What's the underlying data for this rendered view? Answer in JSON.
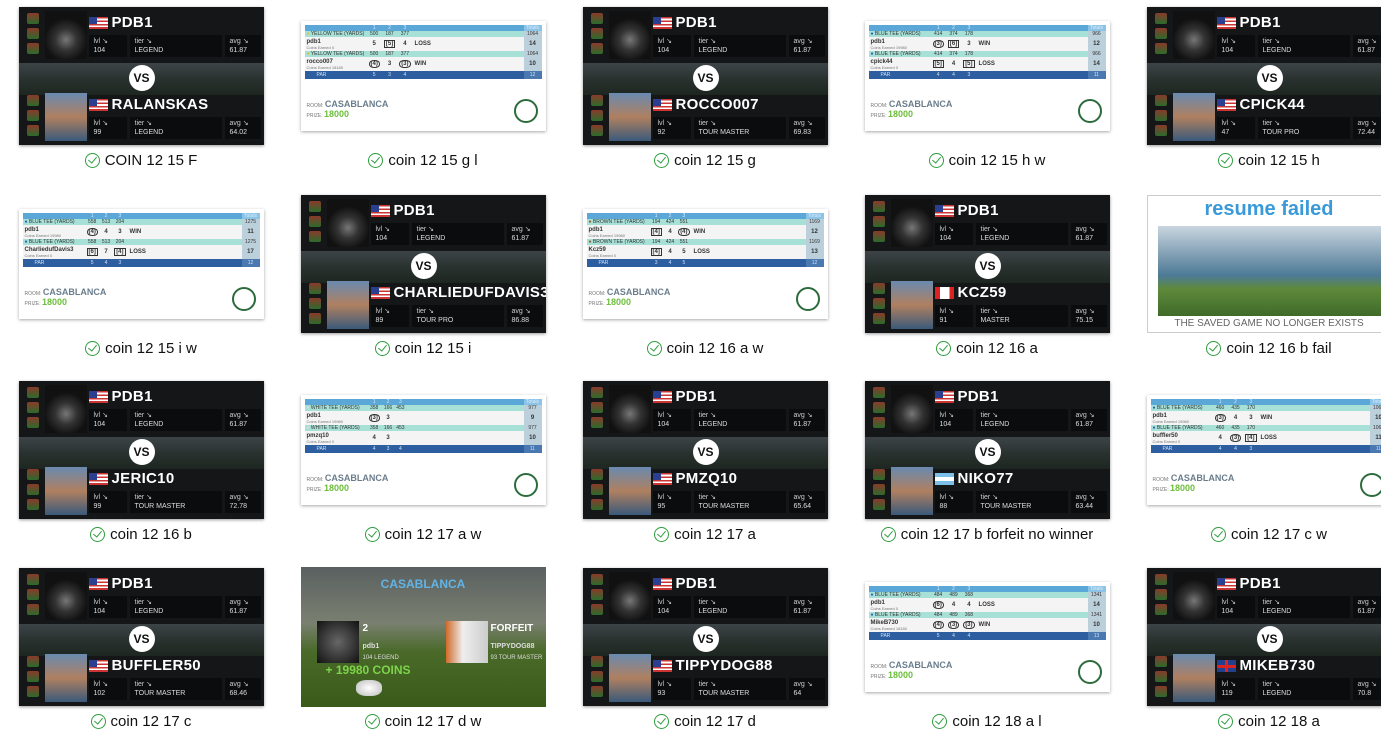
{
  "labels": {
    "lvl": "lvl",
    "tier": "tier",
    "avg": "avg",
    "vs": "VS",
    "room_label": "ROOM:",
    "prize_label": "PRIZE:",
    "coins_earned": "Coins Earned",
    "par": "PAR",
    "totals": "Totals",
    "holes": [
      "1",
      "2",
      "3"
    ]
  },
  "player1": {
    "name": "PDB1",
    "flag": "us",
    "lvl": "104",
    "tier": "LEGEND",
    "avg": "61.87"
  },
  "files": [
    {
      "name": "COIN 12 15 F",
      "type": "vs",
      "opp": {
        "name": "RALANSKAS",
        "flag": "us",
        "lvl": "99",
        "tier": "LEGEND",
        "avg": "64.02"
      }
    },
    {
      "name": "coin 12 15 g l",
      "type": "score",
      "tee": "YELLOW TEE (YARDS)",
      "tee_color": "#e0c030",
      "yards": [
        "500",
        "187",
        "377"
      ],
      "yards_total": "1064",
      "p1": {
        "name": "pdb1",
        "scores": [
          "5",
          "[5]",
          "4"
        ],
        "result": "LOSS",
        "total": "14",
        "coins": "0"
      },
      "p2": {
        "name": "rocco007",
        "scores": [
          "(4)",
          "3",
          "(3)"
        ],
        "result": "WIN",
        "total": "10",
        "coins": "18180"
      },
      "par": [
        "5",
        "3",
        "4"
      ],
      "par_total": "12",
      "room": "CASABLANCA",
      "prize": "18000"
    },
    {
      "name": "coin 12 15 g",
      "type": "vs",
      "opp": {
        "name": "ROCCO007",
        "flag": "us",
        "lvl": "92",
        "tier": "TOUR MASTER",
        "avg": "69.83"
      }
    },
    {
      "name": "coin 12 15 h w",
      "type": "score",
      "tee": "BLUE TEE (YARDS)",
      "tee_color": "#2a5fbf",
      "yards": [
        "414",
        "374",
        "178"
      ],
      "yards_total": "966",
      "p1": {
        "name": "pdb1",
        "scores": [
          "(3)",
          "[6]",
          "3"
        ],
        "result": "WIN",
        "total": "12",
        "coins": "19980"
      },
      "p2": {
        "name": "cpick44",
        "scores": [
          "[5]",
          "4",
          "[5]"
        ],
        "result": "LOSS",
        "total": "14",
        "coins": "0"
      },
      "par": [
        "4",
        "4",
        "3"
      ],
      "par_total": "11",
      "room": "CASABLANCA",
      "prize": "18000"
    },
    {
      "name": "coin 12 15 h",
      "type": "vs",
      "opp": {
        "name": "CPICK44",
        "flag": "us",
        "lvl": "47",
        "tier": "TOUR PRO",
        "avg": "72.44"
      }
    },
    {
      "name": "coin 12 15 i w",
      "type": "score",
      "tee": "BLUE TEE (YARDS)",
      "tee_color": "#2a5fbf",
      "yards": [
        "558",
        "513",
        "204"
      ],
      "yards_total": "1275",
      "p1": {
        "name": "pdb1",
        "scores": [
          "(4)",
          "4",
          "3"
        ],
        "result": "WIN",
        "total": "11",
        "coins": "19980"
      },
      "p2": {
        "name": "CharliedufDavis3",
        "scores": [
          "[6]",
          "7",
          "[4]"
        ],
        "result": "LOSS",
        "total": "17",
        "coins": "0"
      },
      "par": [
        "5",
        "4",
        "3"
      ],
      "par_total": "12",
      "room": "CASABLANCA",
      "prize": "18000"
    },
    {
      "name": "coin 12 15 i",
      "type": "vs",
      "opp": {
        "name": "CHARLIEDUFDAVIS3",
        "flag": "us",
        "lvl": "89",
        "tier": "TOUR PRO",
        "avg": "86.88"
      }
    },
    {
      "name": "coin 12 16 a w",
      "type": "score",
      "tee": "BROWN TEE (YARDS)",
      "tee_color": "#9a5a2a",
      "yards": [
        "194",
        "424",
        "551"
      ],
      "yards_total": "1169",
      "p1": {
        "name": "pdb1",
        "scores": [
          "[4]",
          "4",
          "(4)"
        ],
        "result": "WIN",
        "total": "12",
        "coins": "19980"
      },
      "p2": {
        "name": "Kcz59",
        "scores": [
          "[4]",
          "4",
          "5"
        ],
        "result": "LOSS",
        "total": "13",
        "coins": "0"
      },
      "par": [
        "3",
        "4",
        "5"
      ],
      "par_total": "12",
      "room": "CASABLANCA",
      "prize": "18000"
    },
    {
      "name": "coin 12 16 a",
      "type": "vs",
      "opp": {
        "name": "KCZ59",
        "flag": "ca",
        "lvl": "91",
        "tier": "MASTER",
        "avg": "75.15"
      }
    },
    {
      "name": "coin 12 16 b fail",
      "type": "fail",
      "title": "resume failed",
      "subtitle": "THE SAVED GAME NO LONGER EXISTS"
    },
    {
      "name": "coin 12 16 b",
      "type": "vs",
      "opp": {
        "name": "JERIC10",
        "flag": "us",
        "lvl": "99",
        "tier": "TOUR MASTER",
        "avg": "72.78"
      }
    },
    {
      "name": "coin 12 17 a w",
      "type": "score",
      "tee": "WHITE TEE (YARDS)",
      "tee_color": "#dddddd",
      "yards": [
        "358",
        "166",
        "453"
      ],
      "yards_total": "977",
      "p1": {
        "name": "pdb1",
        "scores": [
          "(3)",
          "3",
          ""
        ],
        "result": "",
        "total": "9",
        "coins": "19980"
      },
      "p2": {
        "name": "pmzq10",
        "scores": [
          "4",
          "3",
          ""
        ],
        "result": "",
        "total": "10",
        "coins": "0"
      },
      "par": [
        "4",
        "3",
        "4"
      ],
      "par_total": "11",
      "room": "CASABLANCA",
      "prize": "18000"
    },
    {
      "name": "coin 12 17 a",
      "type": "vs",
      "opp": {
        "name": "PMZQ10",
        "flag": "us",
        "lvl": "95",
        "tier": "TOUR MASTER",
        "avg": "65.64"
      }
    },
    {
      "name": "coin 12 17 b forfeit no winner",
      "type": "vs",
      "opp": {
        "name": "NIKO77",
        "flag": "ar",
        "lvl": "88",
        "tier": "TOUR MASTER",
        "avg": "63.44"
      }
    },
    {
      "name": "coin 12 17 c w",
      "type": "score",
      "tee": "BLUE TEE (YARDS)",
      "tee_color": "#2a5fbf",
      "yards": [
        "460",
        "435",
        "170"
      ],
      "yards_total": "1065",
      "p1": {
        "name": "pdb1",
        "scores": [
          "(3)",
          "4",
          "3"
        ],
        "result": "WIN",
        "total": "10",
        "coins": "19980"
      },
      "p2": {
        "name": "buffler50",
        "scores": [
          "4",
          "(3)",
          "[4]"
        ],
        "result": "LOSS",
        "total": "11",
        "coins": "0"
      },
      "par": [
        "4",
        "4",
        "3"
      ],
      "par_total": "11",
      "room": "CASABLANCA",
      "prize": "18000"
    },
    {
      "name": "coin 12 17 c",
      "type": "vs",
      "opp": {
        "name": "BUFFLER50",
        "flag": "us",
        "lvl": "102",
        "tier": "TOUR MASTER",
        "avg": "68.46"
      }
    },
    {
      "name": "coin 12 17 d w",
      "type": "forfeit",
      "room": "CASABLANCA",
      "p1_score": "2",
      "p1_name": "pdb1",
      "p1_info": "104  LEGEND",
      "p2_status": "FORFEIT",
      "p2_name": "TIPPYDOG88",
      "p2_info": "93  TOUR MASTER",
      "coins": "+ 19980 COINS"
    },
    {
      "name": "coin 12 17 d",
      "type": "vs",
      "opp": {
        "name": "TIPPYDOG88",
        "flag": "us",
        "lvl": "93",
        "tier": "TOUR MASTER",
        "avg": "64"
      }
    },
    {
      "name": "coin 12 18 a l",
      "type": "score",
      "tee": "BLUE TEE (YARDS)",
      "tee_color": "#2a5fbf",
      "yards": [
        "484",
        "489",
        "368"
      ],
      "yards_total": "1341",
      "p1": {
        "name": "pdb1",
        "scores": [
          "(6)",
          "4",
          "4"
        ],
        "result": "LOSS",
        "total": "14",
        "coins": "0"
      },
      "p2": {
        "name": "MikeB730",
        "scores": [
          "(4)",
          "(3)",
          "(3)"
        ],
        "result": "WIN",
        "total": "10",
        "coins": "18180"
      },
      "par": [
        "5",
        "4",
        "4"
      ],
      "par_total": "13",
      "room": "CASABLANCA",
      "prize": "18000"
    },
    {
      "name": "coin 12 18 a",
      "type": "vs",
      "opp": {
        "name": "MIKEB730",
        "flag": "gb",
        "lvl": "119",
        "tier": "LEGEND",
        "avg": "70.8"
      }
    }
  ]
}
